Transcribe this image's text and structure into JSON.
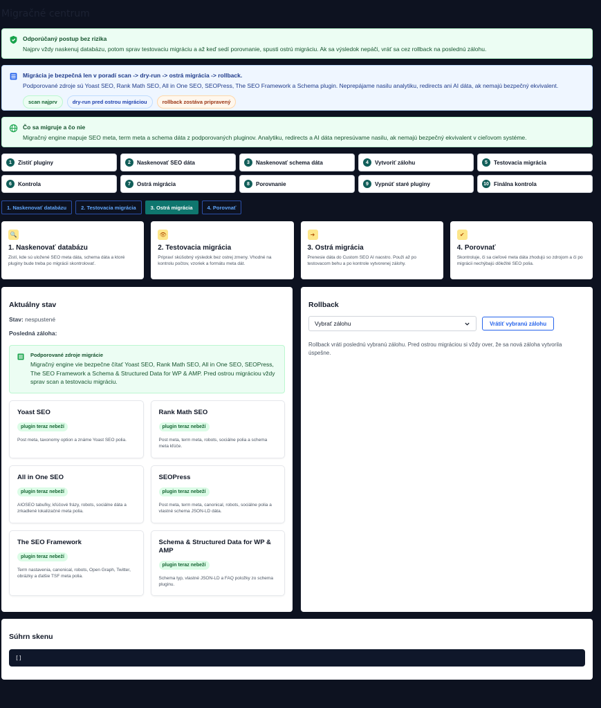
{
  "page_title": "Migračné centrum",
  "notices": {
    "recommended": {
      "title": "Odporúčaný postup bez rizika",
      "body": "Najprv vždy naskenuj databázu, potom sprav testovaciu migráciu a až keď sedí porovnanie, spusti ostrú migráciu. Ak sa výsledok nepáči, vráť sa cez rollback na poslednú zálohu."
    },
    "order": {
      "title": "Migrácia je bezpečná len v poradí scan -> dry-run -> ostrá migrácia -> rollback.",
      "body": "Podporované zdroje sú Yoast SEO, Rank Math SEO, All in One SEO, SEOPress, The SEO Framework a Schema plugin. Neprepájame nasilu analytiku, redirects ani AI dáta, ak nemajú bezpečný ekvivalent.",
      "chips": [
        "scan najprv",
        "dry-run pred ostrou migráciou",
        "rollback zostáva pripravený"
      ]
    },
    "scope": {
      "title": "Čo sa migruje a čo nie",
      "body": "Migračný engine mapuje SEO meta, term meta a schema dáta z podporovaných pluginov. Analytiku, redirects a AI dáta nepresúvame nasilu, ak nemajú bezpečný ekvivalent v cieľovom systéme."
    }
  },
  "steps": [
    {
      "num": "1",
      "label": "Zistiť pluginy"
    },
    {
      "num": "2",
      "label": "Naskenovať SEO dáta"
    },
    {
      "num": "3",
      "label": "Naskenovať schema dáta"
    },
    {
      "num": "4",
      "label": "Vytvoriť zálohu"
    },
    {
      "num": "5",
      "label": "Testovacia migrácia"
    },
    {
      "num": "6",
      "label": "Kontrola"
    },
    {
      "num": "7",
      "label": "Ostrá migrácia"
    },
    {
      "num": "8",
      "label": "Porovnanie"
    },
    {
      "num": "9",
      "label": "Vypnúť staré pluginy"
    },
    {
      "num": "10",
      "label": "Finálna kontrola"
    }
  ],
  "tabs": [
    {
      "label": "1. Naskenovať databázu"
    },
    {
      "label": "2. Testovacia migrácia"
    },
    {
      "label": "3. Ostrá migrácia"
    },
    {
      "label": "4. Porovnať"
    }
  ],
  "phases": [
    {
      "icon": "search-icon",
      "glyph": "🔍",
      "title": "1. Naskenovať databázu",
      "desc": "Zistí, kde sú uložené SEO meta dáta, schema dáta a ktoré pluginy bude treba po migrácii skontrolovať."
    },
    {
      "icon": "eye-icon",
      "glyph": "👁",
      "title": "2. Testovacia migrácia",
      "desc": "Pripraví skúšobný výsledok bez ostrej zmeny. Vhodné na kontrolu počtov, vzoriek a formátu meta dát."
    },
    {
      "icon": "export-icon",
      "glyph": "➜",
      "title": "3. Ostrá migrácia",
      "desc": "Prenesie dáta do Custom SEO AI naostro. Použi až po testovacom behu a po kontrole vytvorenej zálohy."
    },
    {
      "icon": "check-icon",
      "glyph": "✔",
      "title": "4. Porovnať",
      "desc": "Skontroluje, či sa cieľové meta dáta zhodujú so zdrojom a či po migrácii nechýbajú dôležité SEO polia."
    }
  ],
  "status": {
    "heading": "Aktuálny stav",
    "state_label": "Stav:",
    "state_value": "nespustené",
    "backup_label": "Posledná záloha:",
    "support_title": "Podporované zdroje migrácie",
    "support_body": "Migračný engine vie bezpečne čítať Yoast SEO, Rank Math SEO, All in One SEO, SEOPress, The SEO Framework a Schema & Structured Data for WP & AMP. Pred ostrou migráciou vždy sprav scan a testovaciu migráciu."
  },
  "plugins": [
    {
      "name": "Yoast SEO",
      "badge": "plugin teraz nebeží",
      "desc": "Post meta, taxonomy option a známe Yoast SEO polia."
    },
    {
      "name": "Rank Math SEO",
      "badge": "plugin teraz nebeží",
      "desc": "Post meta, term meta, robots, sociálne polia a schema meta kľúče."
    },
    {
      "name": "All in One SEO",
      "badge": "plugin teraz nebeží",
      "desc": "AIOSEO tabuľky, kľúčové frázy, robots, sociálne dáta a zrkadlené lokalizačné meta polia."
    },
    {
      "name": "SEOPress",
      "badge": "plugin teraz nebeží",
      "desc": "Post meta, term meta, canonical, robots, sociálne polia a vlastné schema JSON-LD dáta."
    },
    {
      "name": "The SEO Framework",
      "badge": "plugin teraz nebeží",
      "desc": "Term nastavenia, canonical, robots, Open Graph, Twitter, obrázky a ďalšie TSF meta polia."
    },
    {
      "name": "Schema & Structured Data for WP & AMP",
      "badge": "plugin teraz nebeží",
      "desc": "Schema typ, vlastné JSON-LD a FAQ položky zo schema pluginu."
    }
  ],
  "rollback": {
    "heading": "Rollback",
    "select_value": "Vybrať zálohu",
    "button": "Vrátiť vybranú zálohu",
    "desc": "Rollback vráti poslednú vybranú zálohu. Pred ostrou migráciou si vždy over, že sa nová záloha vytvorila úspešne."
  },
  "summary": {
    "heading": "Súhrn skenu",
    "code": "[]"
  }
}
